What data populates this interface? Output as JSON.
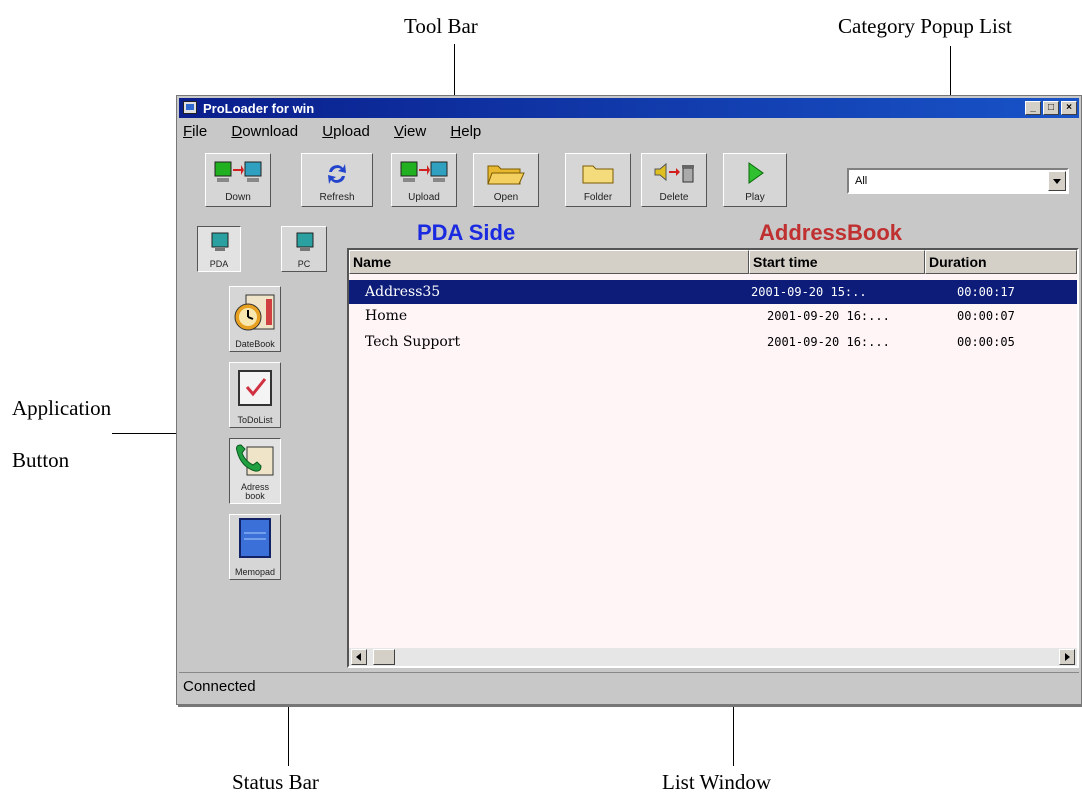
{
  "callouts": {
    "tool_bar": "Tool Bar",
    "category_popup_list": "Category Popup List",
    "application": "Application",
    "button": "Button",
    "status_bar": "Status Bar",
    "list_window": "List Window"
  },
  "window": {
    "title": "ProLoader for win",
    "controls": [
      "minimize-icon",
      "maximize-icon",
      "close-icon"
    ]
  },
  "menu": {
    "file": {
      "first": "F",
      "rest": "ile"
    },
    "download": {
      "first": "D",
      "rest": "ownload"
    },
    "upload": {
      "first": "U",
      "rest": "pload"
    },
    "view": {
      "first": "V",
      "rest": "iew"
    },
    "help": {
      "first": "H",
      "rest": "elp"
    }
  },
  "toolbar": {
    "down": "Down",
    "refresh": "Refresh",
    "upload": "Upload",
    "open": "Open",
    "folder": "Folder",
    "delete": "Delete",
    "play": "Play"
  },
  "category": {
    "selected": "All"
  },
  "side": {
    "pda": "PDA",
    "pc": "PC",
    "datebook": "DateBook",
    "todolist": "ToDoList",
    "address": "Adress\nbook",
    "memopad": "Memopad"
  },
  "list": {
    "side_label": "PDA Side",
    "app_label": "AddressBook",
    "columns": {
      "name": "Name",
      "start": "Start time",
      "duration": "Duration"
    },
    "rows": [
      {
        "name": "Address35",
        "start": "2001-09-20 15:..",
        "duration": "00:00:17"
      },
      {
        "name": "Home",
        "start": "2001-09-20 16:...",
        "duration": "00:00:07"
      },
      {
        "name": "Tech Support",
        "start": "2001-09-20 16:...",
        "duration": "00:00:05"
      }
    ]
  },
  "status": {
    "text": "Connected"
  },
  "colors": {
    "selection": "#0c1c78",
    "pda_side": "#1a2ae0",
    "app_label": "#c03030",
    "titlebar": "#0a1e8c"
  }
}
